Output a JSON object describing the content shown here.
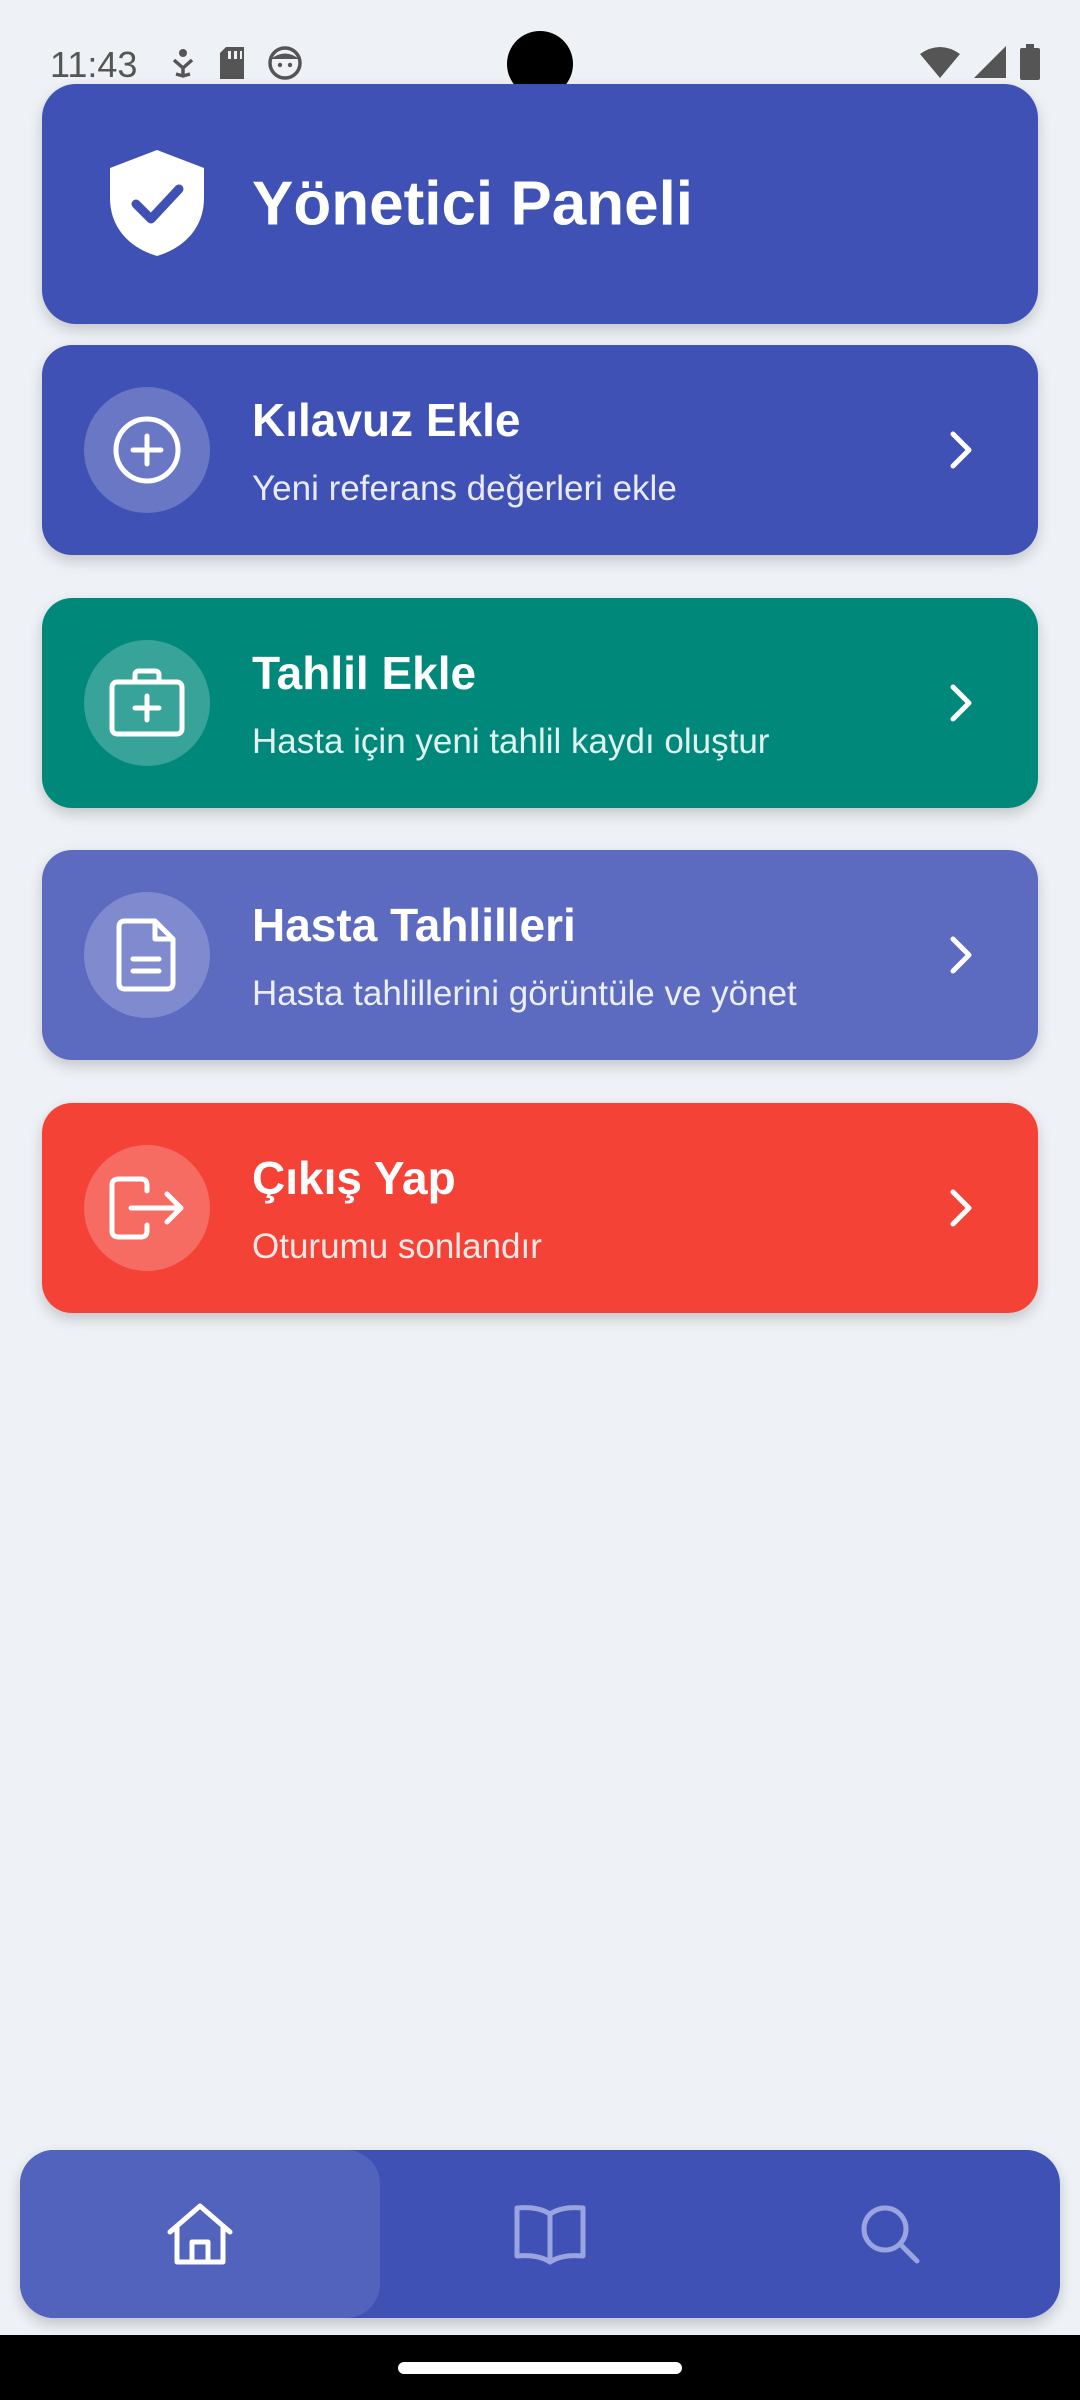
{
  "status_bar": {
    "time": "11:43",
    "left_icons": [
      "accessibility-icon",
      "sd-card-icon",
      "face-icon"
    ],
    "right_icons": [
      "wifi-icon",
      "signal-icon",
      "battery-icon"
    ]
  },
  "header": {
    "title": "Yönetici Paneli",
    "icon": "shield-check-icon",
    "color": "#3f51b5"
  },
  "menu": [
    {
      "title": "Kılavuz Ekle",
      "subtitle": "Yeni referans değerleri ekle",
      "icon": "plus-circle-icon",
      "color": "#3f51b5"
    },
    {
      "title": "Tahlil Ekle",
      "subtitle": "Hasta için yeni tahlil kaydı oluştur",
      "icon": "medical-kit-icon",
      "color": "#00897b"
    },
    {
      "title": "Hasta Tahlilleri",
      "subtitle": "Hasta tahlillerini görüntüle ve yönet",
      "icon": "document-icon",
      "color": "#5c6bc0"
    },
    {
      "title": "Çıkış Yap",
      "subtitle": "Oturumu sonlandır",
      "icon": "logout-icon",
      "color": "#f44336"
    }
  ],
  "bottom_nav": {
    "items": [
      "home-icon",
      "book-icon",
      "search-icon"
    ],
    "active": "home-icon",
    "color": "#3f51b5"
  }
}
